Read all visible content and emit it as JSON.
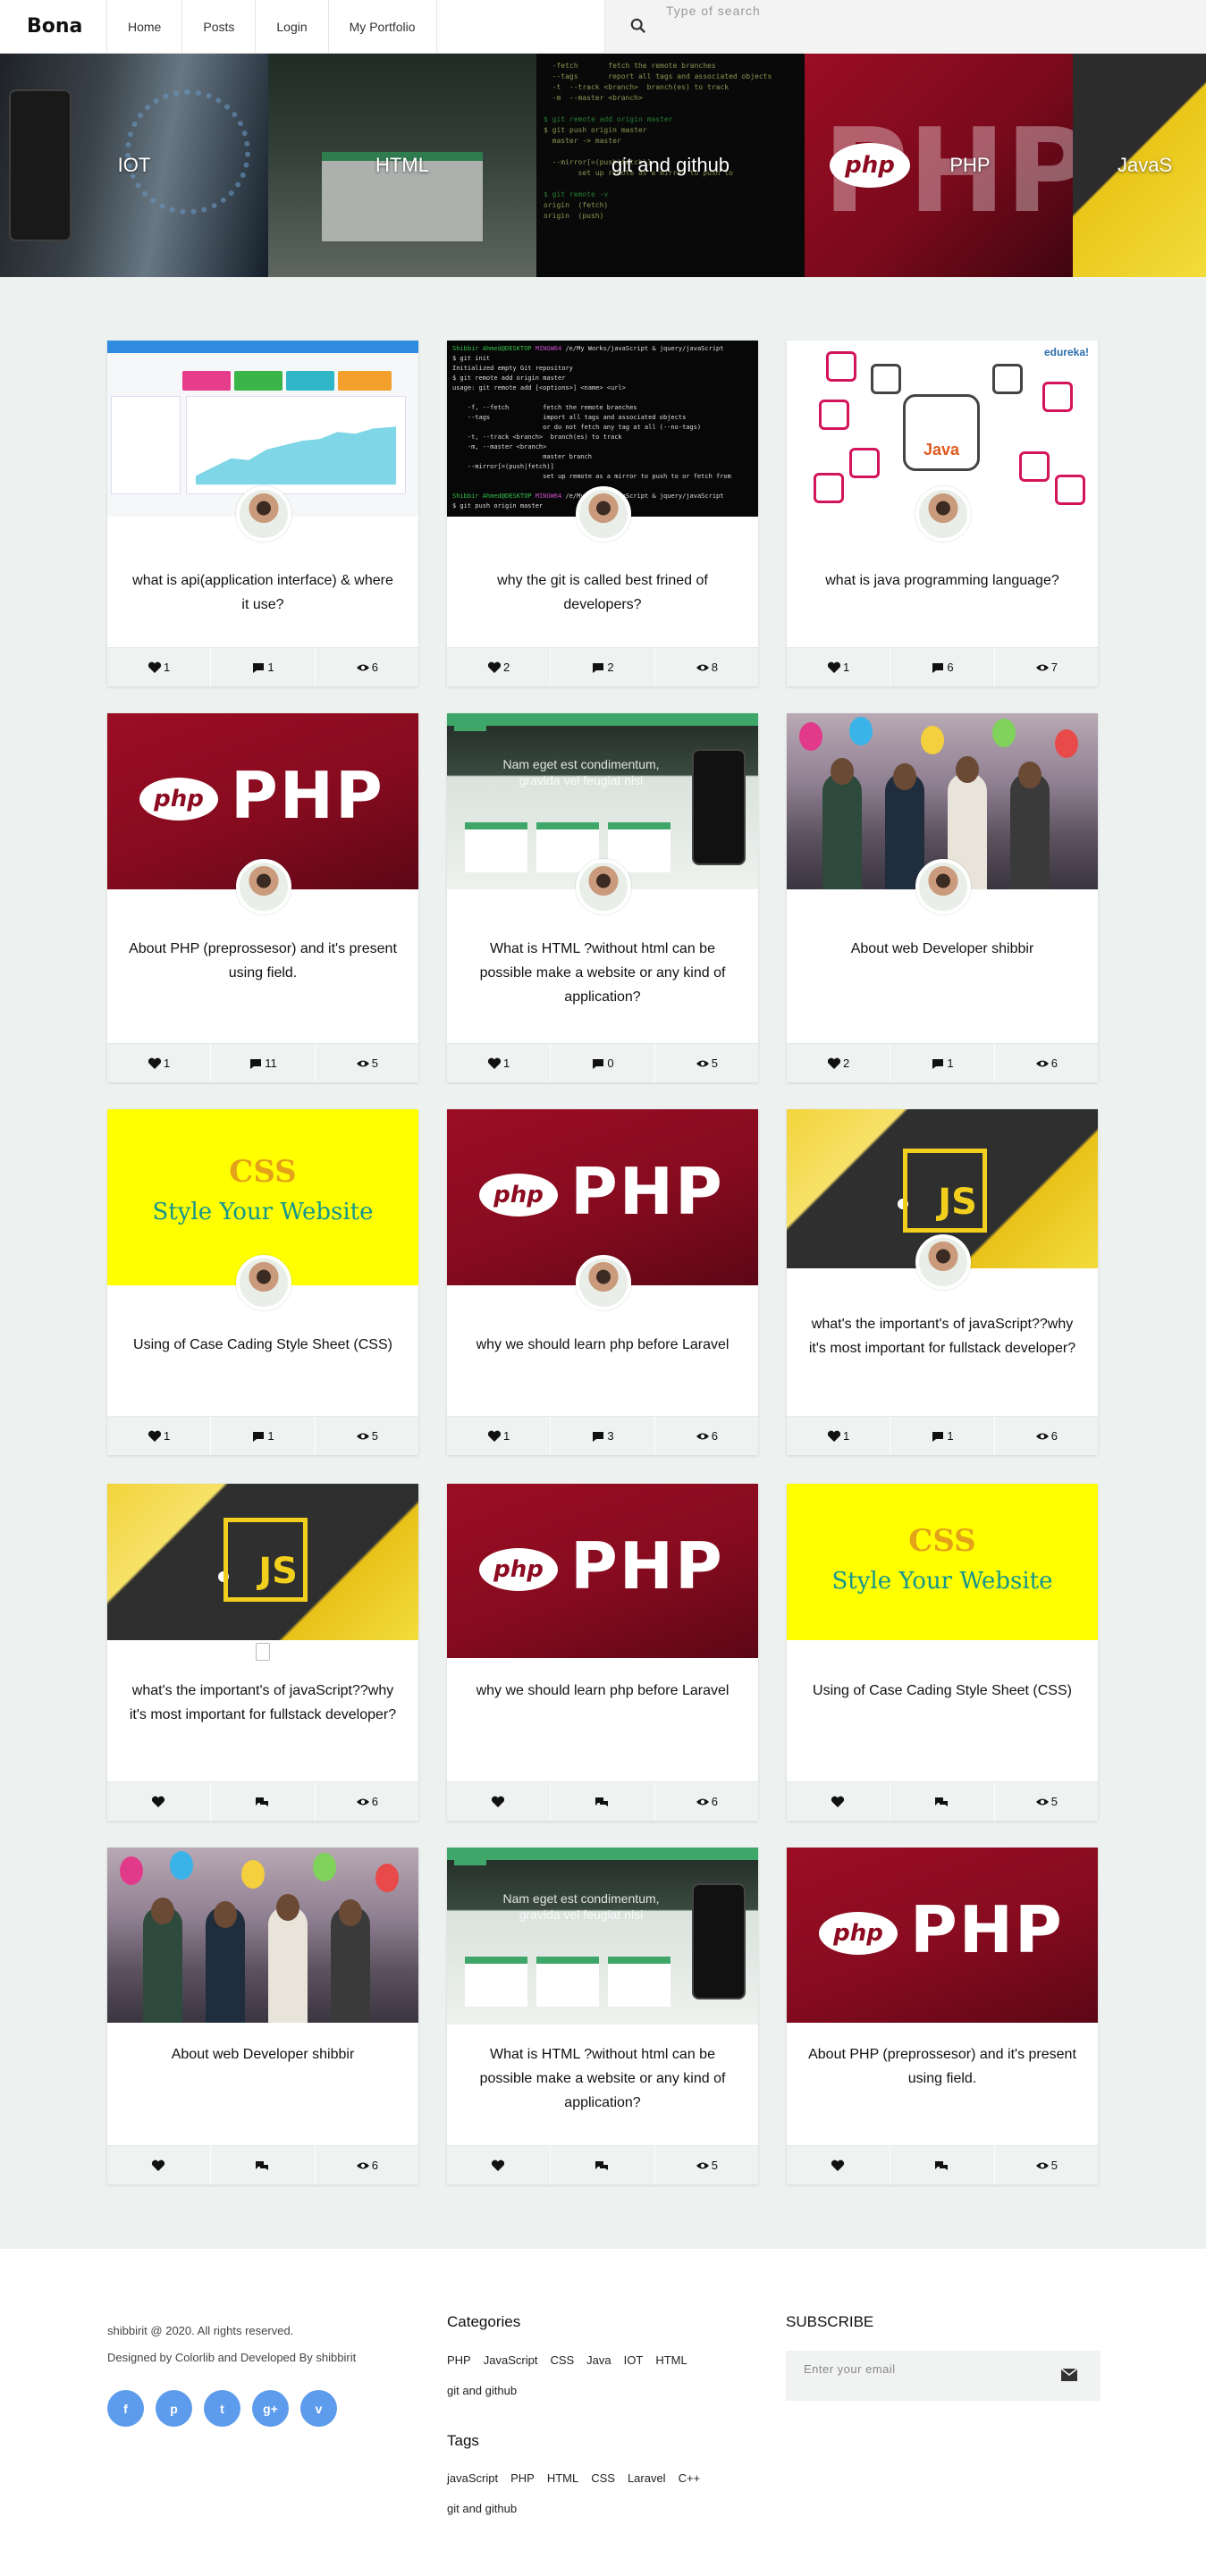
{
  "header": {
    "logo": "Bona",
    "nav": [
      "Home",
      "Posts",
      "Login",
      "My Portfolio"
    ],
    "search_placeholder": "Type of search"
  },
  "slider": [
    "IOT",
    "HTML",
    "git and github",
    "PHP",
    "JavaS"
  ],
  "thumb_text": {
    "php_logo": "php",
    "php_word": "PHP",
    "css_line1": "CSS",
    "css_line2": "Style Your Website",
    "js_word": "JS",
    "html_banner": "Nam eget est condimentum, gravida vel feugiat nisi",
    "java_word": "Java",
    "edureka": "edureka!"
  },
  "cards": [
    {
      "title": "what is api(application interface) & where it use?",
      "likes": "1",
      "comments": "1",
      "views": "6"
    },
    {
      "title": "why the git is called best frined of developers?",
      "likes": "2",
      "comments": "2",
      "views": "8"
    },
    {
      "title": "what is java programming language?",
      "likes": "1",
      "comments": "6",
      "views": "7"
    },
    {
      "title": "About PHP (preprossesor) and it's present using field.",
      "likes": "1",
      "comments": "11",
      "views": "5"
    },
    {
      "title": "What is HTML ?without html can be possible make a website or any kind of application?",
      "likes": "1",
      "comments": "0",
      "views": "5"
    },
    {
      "title": "About web Developer shibbir",
      "likes": "2",
      "comments": "1",
      "views": "6"
    },
    {
      "title": "Using of Case Cading Style Sheet (CSS)",
      "likes": "1",
      "comments": "1",
      "views": "5"
    },
    {
      "title": "why we should learn php before Laravel",
      "likes": "1",
      "comments": "3",
      "views": "6"
    },
    {
      "title": "what's the important's of javaScript??why it's most important for fullstack developer?",
      "likes": "1",
      "comments": "1",
      "views": "6"
    },
    {
      "title": "what's the important's of javaScript??why it's most important for fullstack developer?",
      "likes": "",
      "comments": "",
      "views": "6"
    },
    {
      "title": "why we should learn php before Laravel",
      "likes": "",
      "comments": "",
      "views": "6"
    },
    {
      "title": "Using of Case Cading Style Sheet (CSS)",
      "likes": "",
      "comments": "",
      "views": "5"
    },
    {
      "title": "About web Developer shibbir",
      "likes": "",
      "comments": "",
      "views": "6"
    },
    {
      "title": "What is HTML ?without html can be possible make a website or any kind of application?",
      "likes": "",
      "comments": "",
      "views": "5"
    },
    {
      "title": "About PHP (preprossesor) and it's present using field.",
      "likes": "",
      "comments": "",
      "views": "5"
    }
  ],
  "footer": {
    "copyright": "shibbirit @ 2020. All rights reserved.",
    "credit": "Designed by Colorlib and Developed By shibbirit",
    "socials": [
      "f",
      "p",
      "t",
      "g+",
      "v"
    ],
    "categories_title": "Categories",
    "categories": [
      "PHP",
      "JavaScript",
      "CSS",
      "Java",
      "IOT",
      "HTML",
      "git and github"
    ],
    "tags_title": "Tags",
    "tags": [
      "javaScript",
      "PHP",
      "HTML",
      "CSS",
      "Laravel",
      "C++",
      "git and github"
    ],
    "subscribe_title": "SUBSCRIBE",
    "email_placeholder": "Enter your email"
  }
}
